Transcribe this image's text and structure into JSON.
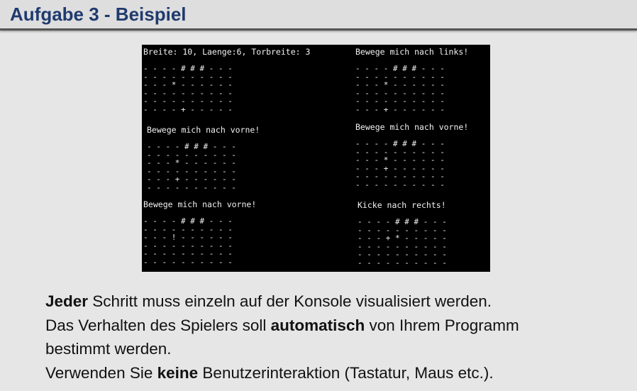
{
  "header": {
    "title": "Aufgabe 3 - Beispiel"
  },
  "console": {
    "status_line": "Breite: 10, Laenge:6, Torbreite: 3",
    "panels": [
      {
        "caption": "",
        "grid": "- - - - # # # - - -\n- - - - - - - - - -\n- - - * - - - - - -\n- - - - - - - - - -\n- - - - - - - - - -\n- - - - + - - - - -"
      },
      {
        "caption": "Bewege mich nach links!",
        "grid": "- - - - # # # - - -\n- - - - - - - - - -\n- - - * - - - - - -\n- - - - - - - - - -\n- - - - - - - - - -\n- - - + - - - - - -"
      },
      {
        "caption": "Bewege mich nach vorne!",
        "grid": "- - - - # # # - - -\n- - - - - - - - - -\n- - - * - - - - - -\n- - - - - - - - - -\n- - - + - - - - - -\n- - - - - - - - - -"
      },
      {
        "caption": "Bewege mich nach vorne!",
        "grid": "- - - - # # # - - -\n- - - - - - - - - -\n- - - * - - - - - -\n- - - + - - - - - -\n- - - - - - - - - -\n- - - - - - - - - -"
      },
      {
        "caption": "Bewege mich nach vorne!",
        "grid": "- - - - # # # - - -\n- - - - - - - - - -\n- - - ! - - - - - -\n- - - - - - - - - -\n- - - - - - - - - -\n- - - - - - - - - -"
      },
      {
        "caption": "Kicke nach rechts!",
        "grid": "- - - - # # # - - -\n- - - - - - - - - -\n- - - + * - - - - -\n- - - - - - - - - -\n- - - - - - - - - -\n- - - - - - - - - -"
      }
    ]
  },
  "instructions": {
    "line1_bold": "Jeder",
    "line1_rest": " Schritt muss einzeln auf der Konsole visualisiert werden.",
    "line2_pre": "Das Verhalten des Spielers soll ",
    "line2_bold": "automatisch",
    "line2_post": " von Ihrem Programm",
    "line3": "bestimmt werden.",
    "line4_pre": "Verwenden Sie ",
    "line4_bold": "keine",
    "line4_post": " Benutzerinteraktion (Tastatur, Maus etc.)."
  }
}
